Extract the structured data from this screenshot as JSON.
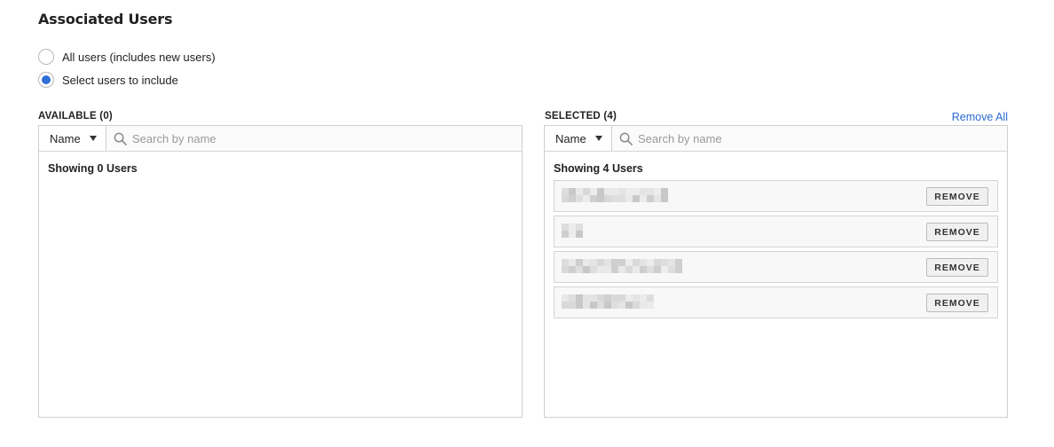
{
  "section_title": "Associated Users",
  "radios": [
    {
      "label": "All users (includes new users)",
      "checked": false
    },
    {
      "label": "Select users to include",
      "checked": true
    }
  ],
  "available": {
    "heading": "AVAILABLE (0)",
    "filter_select": "Name",
    "search_placeholder": "Search by name",
    "showing": "Showing 0 Users"
  },
  "selected": {
    "heading": "SELECTED (4)",
    "remove_all": "Remove All",
    "filter_select": "Name",
    "search_placeholder": "Search by name",
    "showing": "Showing 4 Users",
    "remove_label": "REMOVE",
    "users_count": 4
  },
  "colors": {
    "accent": "#2f6fd6",
    "link": "#2a6ad2",
    "border": "#cfcfcf"
  }
}
